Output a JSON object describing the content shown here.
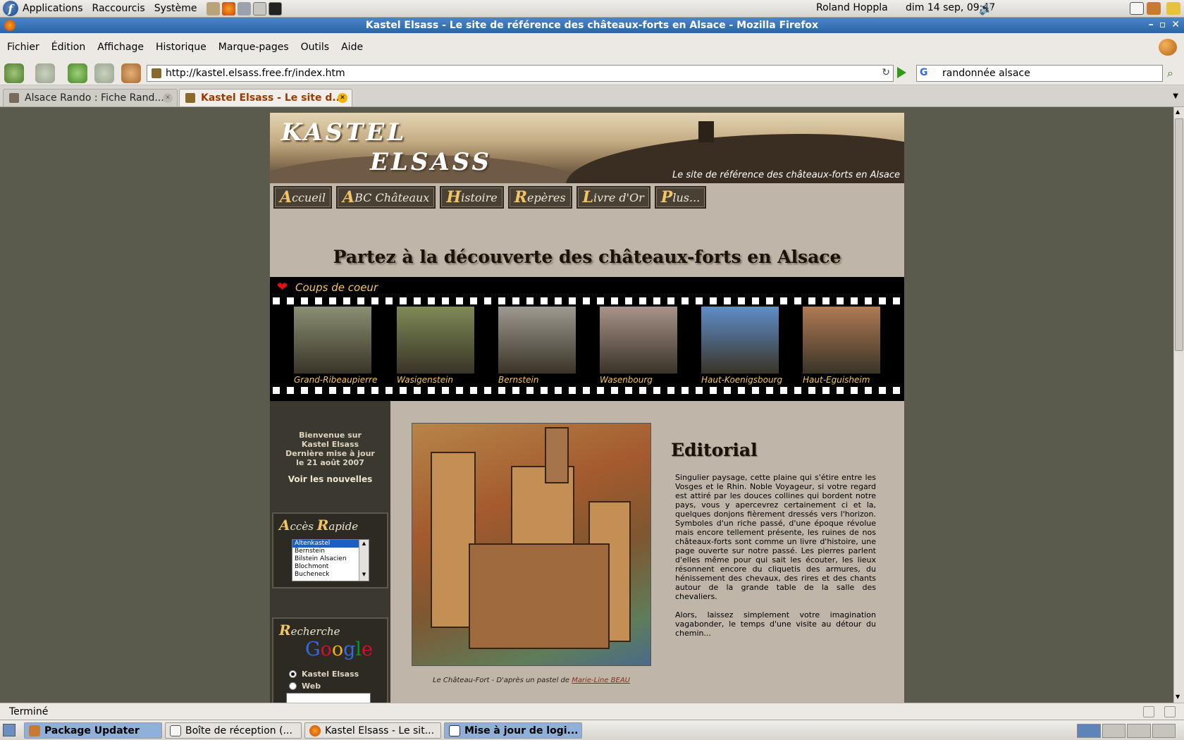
{
  "panel": {
    "menus": [
      "Applications",
      "Raccourcis",
      "Système"
    ],
    "user": "Roland Hoppla",
    "clock": "dim 14 sep, 09:47"
  },
  "window": {
    "title": "Kastel Elsass - Le site de référence des châteaux-forts en Alsace - Mozilla Firefox"
  },
  "menubar": [
    "Fichier",
    "Édition",
    "Affichage",
    "Historique",
    "Marque-pages",
    "Outils",
    "Aide"
  ],
  "navbar": {
    "url": "http://kastel.elsass.free.fr/index.htm",
    "search_value": "randonnée alsace",
    "search_engine": "G"
  },
  "tabs": [
    {
      "label": "Alsace Rando : Fiche Rand...",
      "active": false
    },
    {
      "label": "Kastel Elsass - Le site d...",
      "active": true
    }
  ],
  "site": {
    "logo_line1": "KASTEL",
    "logo_line2": "ELSASS",
    "tagline": "Le site de référence des châteaux-forts en Alsace",
    "nav": [
      {
        "cap": "A",
        "rest": "ccueil"
      },
      {
        "cap": "A",
        "rest": "BC Châteaux"
      },
      {
        "cap": "H",
        "rest": "istoire"
      },
      {
        "cap": "R",
        "rest": "epères"
      },
      {
        "cap": "L",
        "rest": "ivre d'Or"
      },
      {
        "cap": "P",
        "rest": "lus..."
      }
    ],
    "headline": "Partez à la découverte des châteaux-forts en Alsace",
    "coups_title": "Coups de coeur",
    "castles": [
      {
        "name": "Grand-Ribeaupierre",
        "color": "#8a8f72"
      },
      {
        "name": "Wasigenstein",
        "color": "#7e8a56"
      },
      {
        "name": "Bernstein",
        "color": "#9e9990"
      },
      {
        "name": "Wasenbourg",
        "color": "#a8938a"
      },
      {
        "name": "Haut-Koenigsbourg",
        "color": "#5f8dc9"
      },
      {
        "name": "Haut-Eguisheim",
        "color": "#b07a52"
      }
    ],
    "welcome": [
      "Bienvenue sur",
      "Kastel Elsass",
      "Dernière mise à jour",
      "le 21 août 2007"
    ],
    "news_link": "Voir les nouvelles",
    "acces": {
      "cap1": "A",
      "rest1": "ccès ",
      "cap2": "R",
      "rest2": "apide"
    },
    "castle_options": [
      "Altenkastel",
      "Bernstein",
      "Bilstein Alsacien",
      "Blochmont",
      "Bucheneck"
    ],
    "recherche": {
      "cap": "R",
      "rest": "echerche",
      "google": "Google",
      "opt1": "Kastel Elsass",
      "opt2": "Web"
    },
    "painting_caption": "Le Château-Fort - D'après un pastel de ",
    "painting_author": "Marie-Line BEAU",
    "editorial_title": "Editorial",
    "editorial_p1": "Singulier paysage, cette plaine qui s'étire entre les Vosges et le Rhin. Noble Voyageur, si votre regard est attiré par les douces collines qui bordent notre pays, vous y apercevrez certainement ci et la, quelques donjons fièrement dressés vers l'horizon. Symboles d'un riche passé, d'une époque révolue mais encore tellement présente, les ruines de nos châteaux-forts sont comme un livre d'histoire, une page ouverte sur notre passé. Les pierres parlent d'elles même pour qui sait les écouter, les lieux résonnent encore du cliquetis des armures, du hénissement des chevaux, des rires et des chants autour de la grande table de la salle des chevaliers.",
    "editorial_p2": "Alors, laissez simplement votre imagination vagabonder, le temps d'une visite au détour du chemin..."
  },
  "status": "Terminé",
  "taskbar": [
    {
      "label": "Package Updater",
      "active": true
    },
    {
      "label": "Boîte de réception (...",
      "active": false
    },
    {
      "label": "Kastel Elsass - Le sit...",
      "active": false
    },
    {
      "label": "Mise à jour de logi...",
      "active": true
    }
  ]
}
